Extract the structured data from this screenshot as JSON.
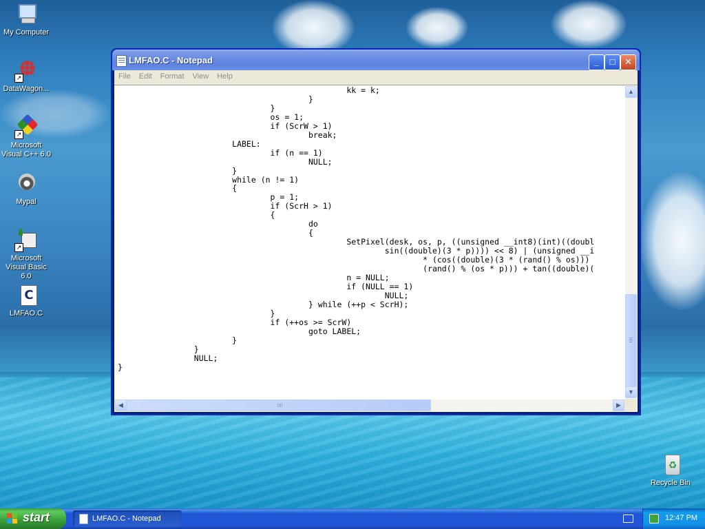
{
  "desktop": {
    "icons": [
      {
        "label": "My Computer",
        "icon": "my-computer-icon"
      },
      {
        "label": "DataWagon...",
        "icon": "datawagon-icon"
      },
      {
        "label": "Microsoft Visual C++ 6.0",
        "icon": "visual-cpp-icon"
      },
      {
        "label": "Mypal",
        "icon": "mypal-icon"
      },
      {
        "label": "Microsoft Visual Basic 6.0",
        "icon": "visual-basic-icon"
      },
      {
        "label": "LMFAO.C",
        "icon": "c-file-icon"
      },
      {
        "label": "Recycle Bin",
        "icon": "recycle-bin-icon"
      }
    ]
  },
  "window": {
    "title": "LMFAO.C - Notepad",
    "menu": [
      "File",
      "Edit",
      "Format",
      "View",
      "Help"
    ],
    "controls": {
      "minimize": "_",
      "maximize": "□",
      "close": "✕"
    },
    "code_lines": [
      "\t\t\t\t\t\tkk = k;",
      "\t\t\t\t\t}",
      "\t\t\t\t}",
      "\t\t\t\tos = 1;",
      "\t\t\t\tif (ScrW > 1)",
      "\t\t\t\t\tbreak;",
      "\t\t\tLABEL:",
      "\t\t\t\tif (n == 1)",
      "\t\t\t\t\tNULL;",
      "\t\t\t}",
      "\t\t\twhile (n != 1)",
      "\t\t\t{",
      "\t\t\t\tp = 1;",
      "\t\t\t\tif (ScrH > 1)",
      "\t\t\t\t{",
      "\t\t\t\t\tdo",
      "\t\t\t\t\t{",
      "\t\t\t\t\t\tSetPixel(desk, os, p, ((unsigned __int8)(int)((doubl",
      "\t\t\t\t\t\t\tsin((double)(3 * p)))) << 8) | (unsigned __i",
      "\t\t\t\t\t\t\t\t* (cos((double)(3 * (rand() % os)))",
      "\t\t\t\t\t\t\t\t(rand() % (os * p))) + tan((double)(",
      "\t\t\t\t\t\tn = NULL;",
      "\t\t\t\t\t\tif (NULL == 1)",
      "\t\t\t\t\t\t\tNULL;",
      "\t\t\t\t\t} while (++p < ScrH);",
      "\t\t\t\t}",
      "\t\t\t\tif (++os >= ScrW)",
      "\t\t\t\t\tgoto LABEL;",
      "\t\t\t}",
      "\t\t}",
      "\t\tNULL;",
      "}"
    ]
  },
  "taskbar": {
    "start_label": "start",
    "task_button": "LMFAO.C - Notepad",
    "clock": "12:47 PM"
  }
}
